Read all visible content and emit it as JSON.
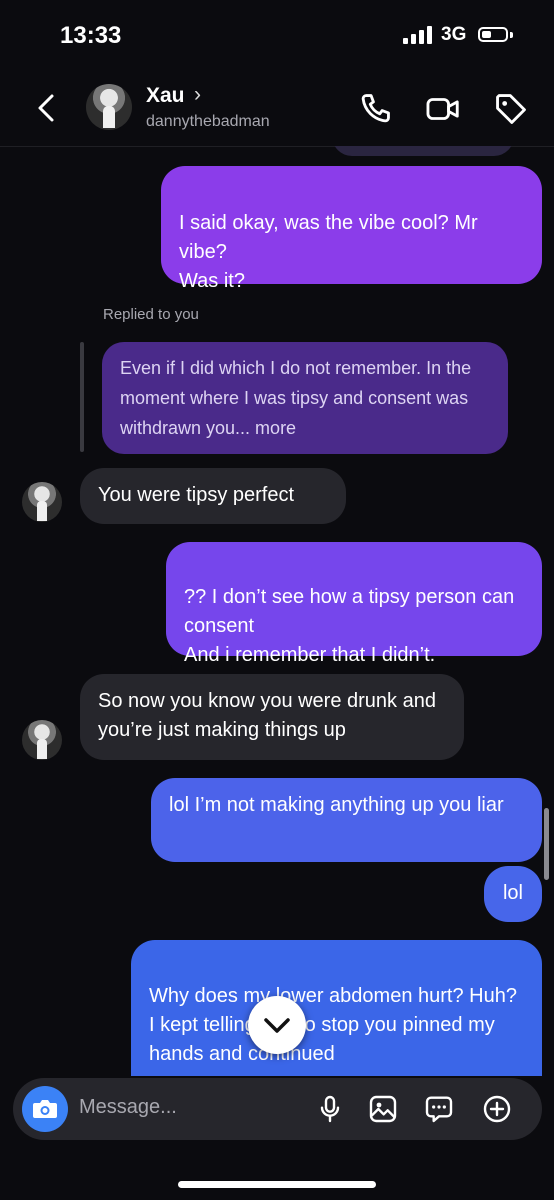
{
  "status_bar": {
    "time": "13:33",
    "network": "3G"
  },
  "header": {
    "name": "Xau",
    "chevron": "›",
    "username": "dannythebadman"
  },
  "reply": {
    "label": "Replied to you",
    "quote": "Even if I did which I do not remember. In the moment where I was tipsy and consent was withdrawn you... more"
  },
  "messages": {
    "m1": "I said okay, was the vibe cool? Mr vibe?\nWas it?",
    "m2": "You were tipsy perfect",
    "m3": "?? I don’t see how a tipsy person can consent\nAnd i remember that I didn’t.",
    "m4": "So now you know you were drunk and you’re just making things up",
    "m5": "lol I’m not making anything up you liar",
    "m6": "lol",
    "m7": "Why does my lower abdomen hurt? Huh?\nI kept telling you to stop you pinned my hands and continued"
  },
  "composer": {
    "placeholder": "Message..."
  },
  "icons": {
    "back": "chevron-left-icon",
    "call": "phone-icon",
    "video": "video-camera-icon",
    "tag": "tag-icon",
    "camera": "camera-icon",
    "mic": "microphone-icon",
    "gallery": "image-icon",
    "sticker": "chat-bubble-icon",
    "more": "plus-circle-icon",
    "scroll": "chevron-down-icon"
  },
  "colors": {
    "background": "#0b0b0f",
    "incoming_bubble": "#26262c",
    "outgoing_top": "#8b3dea",
    "outgoing_bottom": "#3b66e8",
    "accent_blue": "#3b82f6"
  }
}
